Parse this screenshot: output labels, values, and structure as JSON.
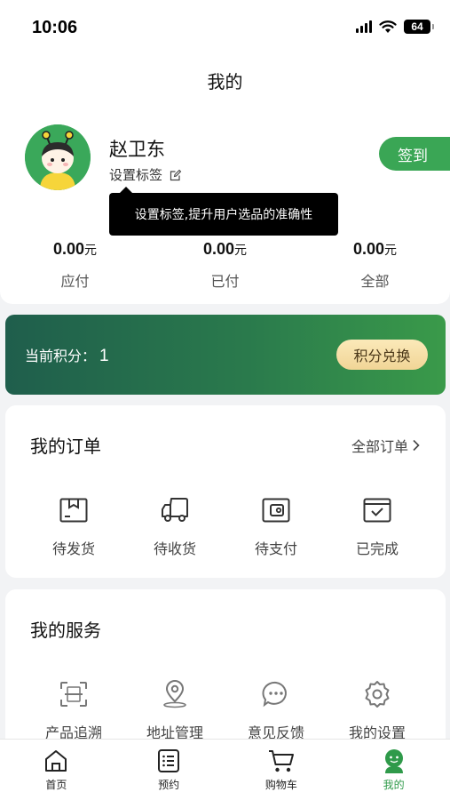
{
  "status": {
    "time": "10:06",
    "battery": "64"
  },
  "page": {
    "title": "我的"
  },
  "user": {
    "name": "赵卫东",
    "set_tag_label": "设置标签",
    "signin_label": "签到",
    "tooltip": "设置标签,提升用户选品的准确性"
  },
  "stats": [
    {
      "value": "0.00",
      "unit": "元",
      "label": "应付"
    },
    {
      "value": "0.00",
      "unit": "元",
      "label": "已付"
    },
    {
      "value": "0.00",
      "unit": "元",
      "label": "全部"
    }
  ],
  "points": {
    "label": "当前积分：",
    "value": "1",
    "button": "积分兑换"
  },
  "orders": {
    "title": "我的订单",
    "all_link": "全部订单",
    "items": [
      {
        "label": "待发货",
        "icon": "package-icon"
      },
      {
        "label": "待收货",
        "icon": "truck-icon"
      },
      {
        "label": "待支付",
        "icon": "wallet-icon"
      },
      {
        "label": "已完成",
        "icon": "check-box-icon"
      }
    ]
  },
  "services": {
    "title": "我的服务",
    "items": [
      {
        "label": "产品追溯",
        "icon": "scan-icon"
      },
      {
        "label": "地址管理",
        "icon": "location-icon"
      },
      {
        "label": "意见反馈",
        "icon": "chat-icon"
      },
      {
        "label": "我的设置",
        "icon": "gear-icon"
      }
    ]
  },
  "tabs": [
    {
      "label": "首页",
      "icon": "home-icon"
    },
    {
      "label": "预约",
      "icon": "list-icon"
    },
    {
      "label": "购物车",
      "icon": "cart-icon"
    },
    {
      "label": "我的",
      "icon": "profile-icon",
      "active": true
    }
  ],
  "colors": {
    "accent": "#3aa655",
    "points_gradient_start": "#1f5e4c",
    "points_gradient_end": "#3a9a4a",
    "points_button": "#f1d596"
  }
}
